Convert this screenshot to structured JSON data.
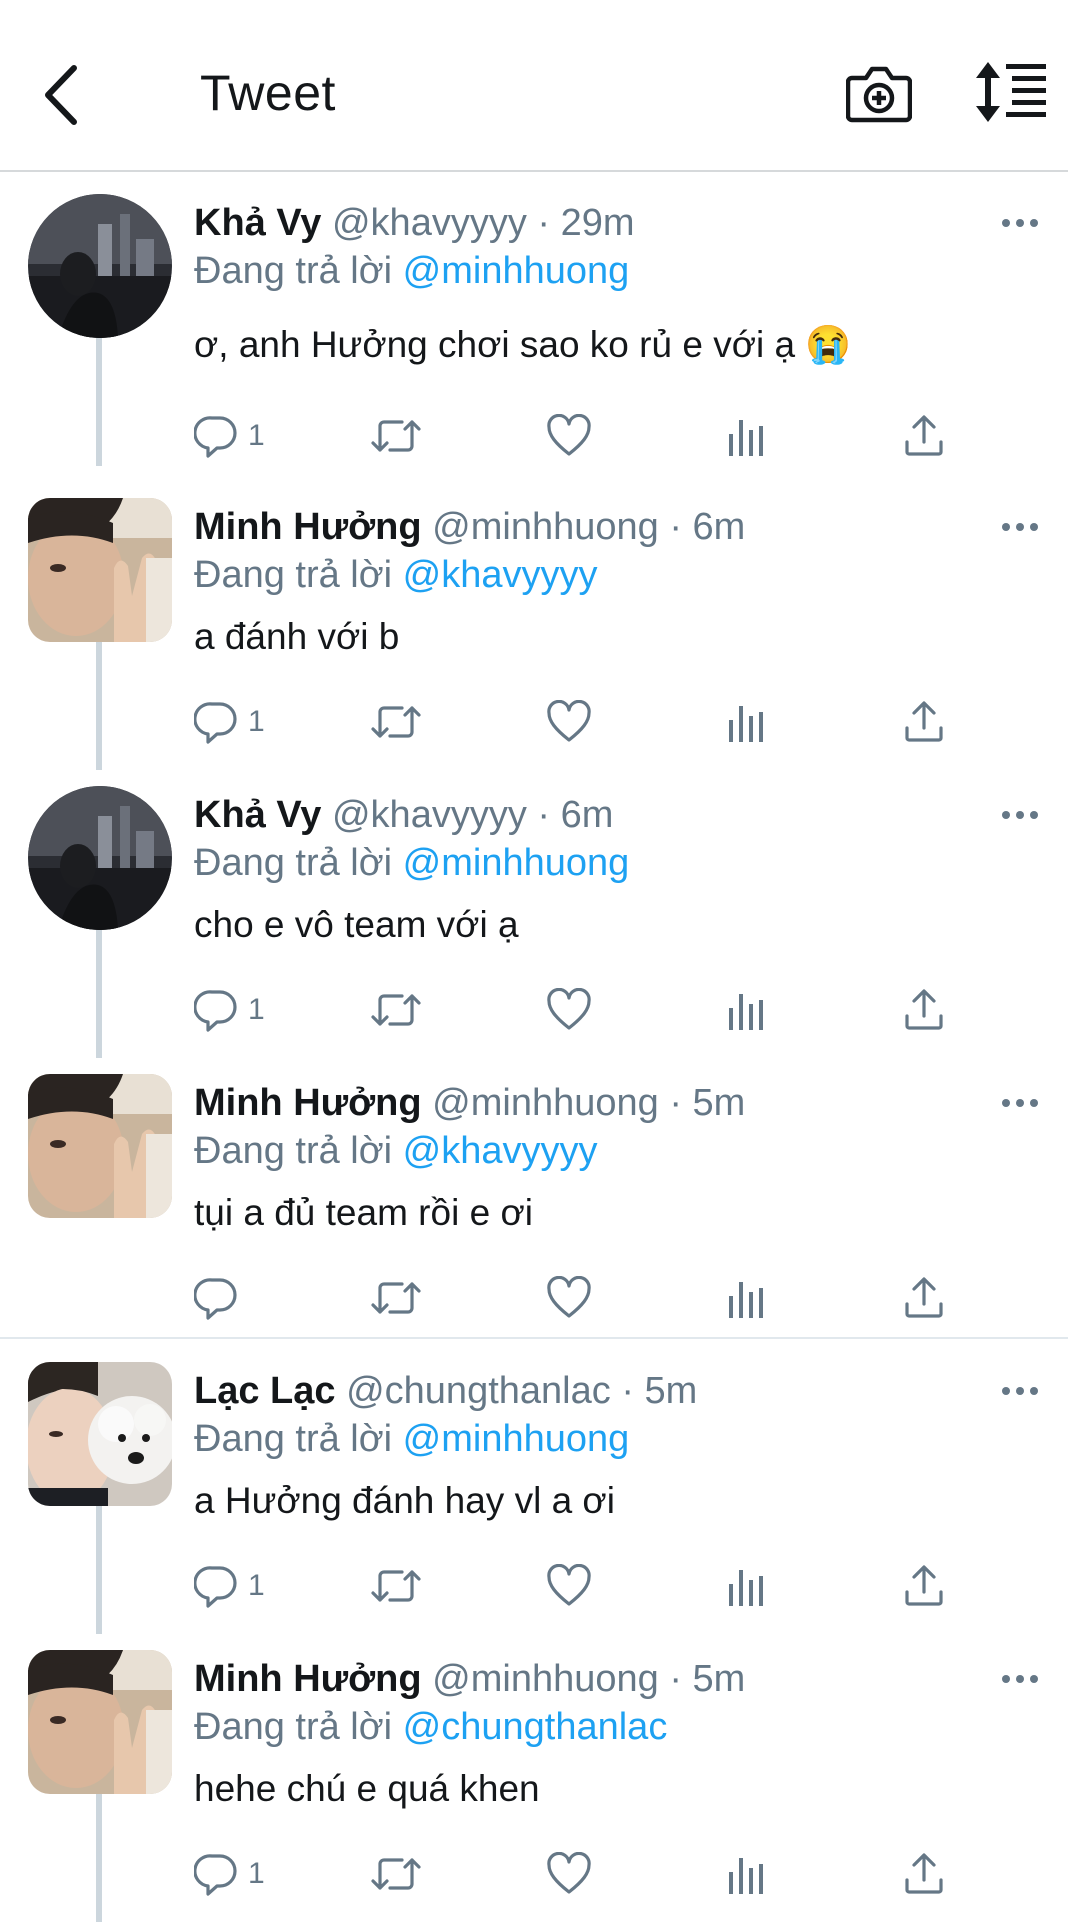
{
  "header": {
    "title": "Tweet",
    "back_icon": "back-arrow-icon",
    "camera_icon": "camera-plus-icon",
    "sort_icon": "sort-lines-icon"
  },
  "reply_prefix": "Đang trả lời",
  "colors": {
    "accent": "#1da1f2",
    "muted": "#657786",
    "text": "#14171a",
    "thread_line": "#ccd6dd"
  },
  "tweets": [
    {
      "name": "Khả Vy",
      "handle": "@khavyyyy",
      "time": "29m",
      "reply_to": "@minhhuong",
      "text": "ơ, anh Hưởng chơi sao ko rủ e với ạ 😭",
      "reply_count": "1"
    },
    {
      "name": "Minh Hưởng",
      "handle": "@minhhuong",
      "time": "6m",
      "reply_to": "@khavyyyy",
      "text": "a đánh với b",
      "reply_count": "1"
    },
    {
      "name": "Khả Vy",
      "handle": "@khavyyyy",
      "time": "6m",
      "reply_to": "@minhhuong",
      "text": "cho e vô team với ạ",
      "reply_count": "1"
    },
    {
      "name": "Minh Hưởng",
      "handle": "@minhhuong",
      "time": "5m",
      "reply_to": "@khavyyyy",
      "text": "tụi a đủ team rồi e ơi",
      "reply_count": ""
    },
    {
      "name": "Lạc Lạc",
      "handle": "@chungthanlac",
      "time": "5m",
      "reply_to": "@minhhuong",
      "text": "a Hưởng đánh hay vl a ơi",
      "reply_count": "1"
    },
    {
      "name": "Minh Hưởng",
      "handle": "@minhhuong",
      "time": "5m",
      "reply_to": "@chungthanlac",
      "text": "hehe chú e quá khen",
      "reply_count": "1"
    }
  ]
}
